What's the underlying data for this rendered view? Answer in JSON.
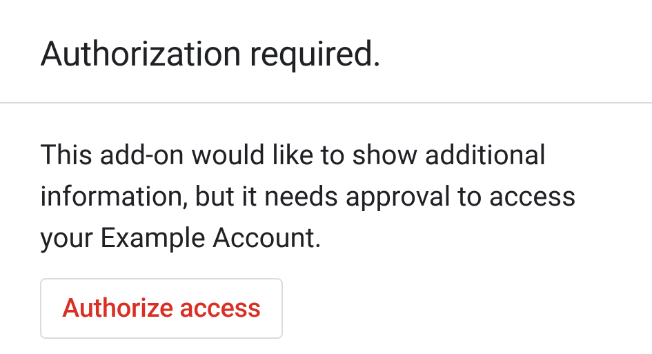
{
  "header": {
    "title": "Authorization required."
  },
  "body": {
    "description": "This add-on would like to show additional information, but it needs approval to access your Example Account.",
    "authorize_label": "Authorize access"
  }
}
